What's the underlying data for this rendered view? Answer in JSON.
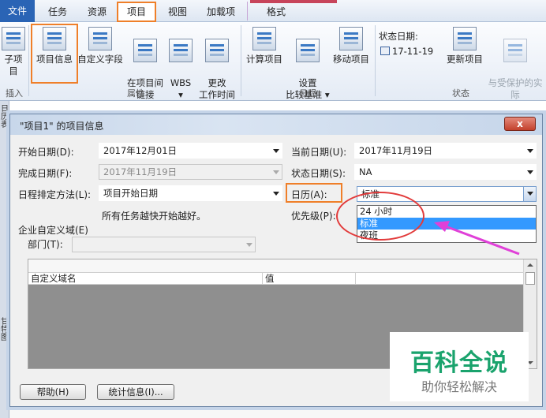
{
  "tabs": [
    "文件",
    "任务",
    "资源",
    "项目",
    "视图",
    "加载项",
    "格式"
  ],
  "ribbon": {
    "buttons": [
      {
        "label": "子项目",
        "icon": "subproject-icon"
      },
      {
        "label": "项目信息",
        "icon": "project-info-icon"
      },
      {
        "label": "自定义字段",
        "icon": "custom-fields-icon"
      },
      {
        "label": "在项目间\n链接",
        "icon": "link-projects-icon"
      },
      {
        "label": "WBS\n▾",
        "icon": "wbs-icon"
      },
      {
        "label": "更改\n工作时间",
        "icon": "change-working-time-icon"
      },
      {
        "label": "计算项目",
        "icon": "calculate-project-icon"
      },
      {
        "label": "设置\n比较基准 ▾",
        "icon": "set-baseline-icon"
      },
      {
        "label": "移动项目",
        "icon": "move-project-icon"
      },
      {
        "label": "更新项目",
        "icon": "update-project-icon"
      },
      {
        "label": "与受保护的实际\n同步",
        "icon": "sync-protected-icon"
      }
    ],
    "groups": [
      "插入",
      "属性",
      "日程",
      "状态"
    ],
    "status_date_label": "状态日期:",
    "status_date_value": "17-11-19"
  },
  "left_strip": {
    "top_label": "日历表",
    "bottom_label": "甘特图"
  },
  "dialog": {
    "title": "\"项目1\" 的项目信息",
    "close": "x",
    "start_date_label": "开始日期(D):",
    "start_date_value": "2017年12月01日",
    "finish_date_label": "完成日期(F):",
    "finish_date_value": "2017年11月19日",
    "schedule_from_label": "日程排定方法(L):",
    "schedule_from_value": "项目开始日期",
    "schedule_note": "所有任务越快开始越好。",
    "current_date_label": "当前日期(U):",
    "current_date_value": "2017年11月19日",
    "status_date_label": "状态日期(S):",
    "status_date_value": "NA",
    "calendar_label": "日历(A):",
    "calendar_value": "标准",
    "calendar_options": [
      "24 小时",
      "标准",
      "夜班"
    ],
    "calendar_selected_index": 1,
    "priority_label": "优先级(P):",
    "enterprise_label": "企业自定义域(E)",
    "department_label": "部门(T):",
    "grid_col_name": "自定义域名",
    "grid_col_value": "值",
    "help_button": "帮助(H)",
    "statistics_button": "统计信息(I)..."
  },
  "watermark": {
    "main": "百科全说",
    "sub": "助你轻松解决"
  },
  "colors": {
    "highlight": "#ef7f29",
    "ellipse": "#e23b3b",
    "arrow": "#e040d8",
    "selected": "#3399ff",
    "watermark": "#1aa36d"
  }
}
